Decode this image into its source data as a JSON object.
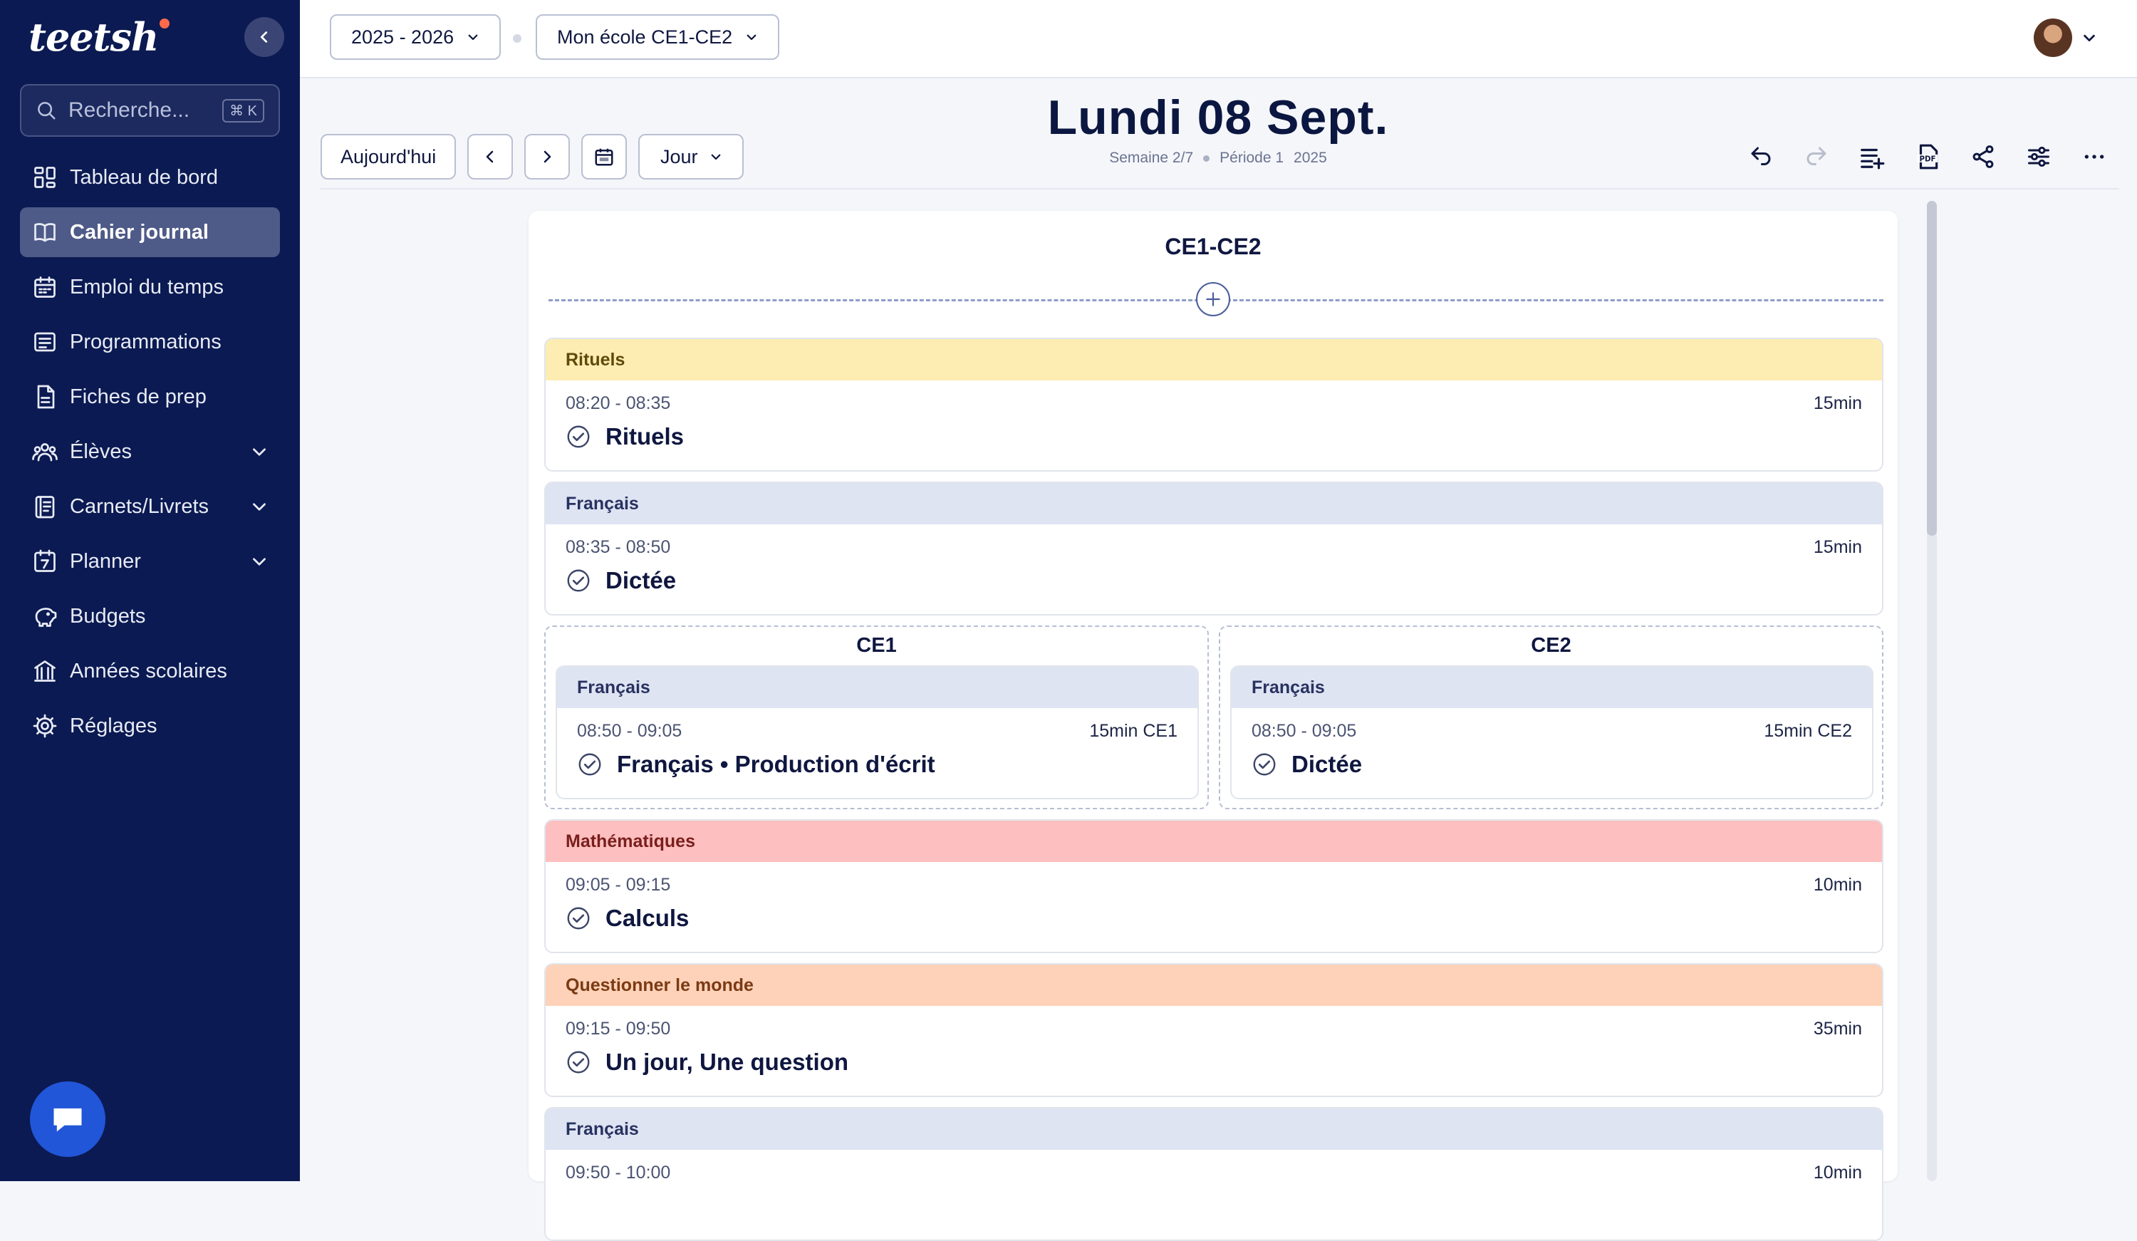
{
  "app": {
    "logo": "teetsh"
  },
  "search": {
    "placeholder": "Recherche...",
    "shortcut": "⌘ K"
  },
  "nav": [
    {
      "label": "Tableau de bord",
      "icon": "dashboard-icon",
      "active": false,
      "expandable": false
    },
    {
      "label": "Cahier journal",
      "icon": "book-icon",
      "active": true,
      "expandable": false
    },
    {
      "label": "Emploi du temps",
      "icon": "calendar-icon",
      "active": false,
      "expandable": false
    },
    {
      "label": "Programmations",
      "icon": "list-icon",
      "active": false,
      "expandable": false
    },
    {
      "label": "Fiches de prep",
      "icon": "document-icon",
      "active": false,
      "expandable": false
    },
    {
      "label": "Élèves",
      "icon": "users-icon",
      "active": false,
      "expandable": true
    },
    {
      "label": "Carnets/Livrets",
      "icon": "notebook-icon",
      "active": false,
      "expandable": true
    },
    {
      "label": "Planner",
      "icon": "planner-icon",
      "active": false,
      "expandable": true
    },
    {
      "label": "Budgets",
      "icon": "piggy-bank-icon",
      "active": false,
      "expandable": false
    },
    {
      "label": "Années scolaires",
      "icon": "school-icon",
      "active": false,
      "expandable": false
    },
    {
      "label": "Réglages",
      "icon": "gear-icon",
      "active": false,
      "expandable": false
    }
  ],
  "topbar": {
    "year": "2025 - 2026",
    "school": "Mon école CE1-CE2"
  },
  "toolbar": {
    "today": "Aujourd'hui",
    "view": "Jour"
  },
  "day": {
    "title": "Lundi 08 Sept.",
    "week": "Semaine 2/7",
    "period": "Période 1",
    "year": "2025"
  },
  "journal": {
    "class": "CE1-CE2",
    "blocks": [
      {
        "subject": "Rituels",
        "color": "yellow",
        "time": "08:20 - 08:35",
        "duration": "15min",
        "activity": "Rituels"
      },
      {
        "subject": "Français",
        "color": "blue",
        "time": "08:35 - 08:50",
        "duration": "15min",
        "activity": "Dictée"
      }
    ],
    "split": {
      "ce1": {
        "title": "CE1",
        "subject": "Français",
        "time": "08:50 - 09:05",
        "duration": "15min CE1",
        "activity": "Français • Production d'écrit"
      },
      "ce2": {
        "title": "CE2",
        "subject": "Français",
        "time": "08:50 - 09:05",
        "duration": "15min CE2",
        "activity": "Dictée"
      }
    },
    "blocks2": [
      {
        "subject": "Mathématiques",
        "color": "red",
        "time": "09:05 - 09:15",
        "duration": "10min",
        "activity": "Calculs"
      },
      {
        "subject": "Questionner le monde",
        "color": "orange",
        "time": "09:15 - 09:50",
        "duration": "35min",
        "activity": "Un jour, Une question"
      },
      {
        "subject": "Français",
        "color": "blue",
        "time": "09:50 - 10:00",
        "duration": "10min",
        "activity": ""
      }
    ]
  }
}
